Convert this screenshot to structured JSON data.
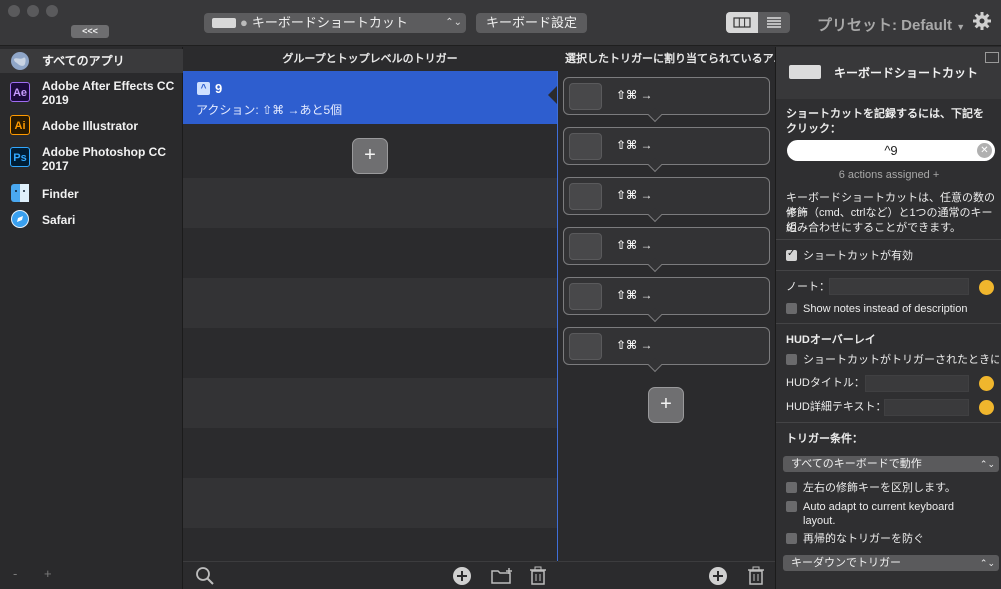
{
  "toolbar": {
    "collapse_label": "<<<",
    "trigger_type": "キーボードショートカット",
    "keyboard_settings": "キーボード設定",
    "preset": "プリセット: Default"
  },
  "headers": {
    "groups": "グループとトップレベルのトリガー",
    "actions": "選択したトリガーに割り当てられているア..."
  },
  "apps": [
    {
      "name": "すべてのアプリ",
      "icon": "globe-icon"
    },
    {
      "name": "Adobe After Effects CC 2019",
      "icon": "after-effects-icon",
      "badge": "Ae"
    },
    {
      "name": "Adobe Illustrator",
      "icon": "illustrator-icon",
      "badge": "Ai"
    },
    {
      "name": "Adobe Photoshop CC 2017",
      "icon": "photoshop-icon",
      "badge": "Ps"
    },
    {
      "name": "Finder",
      "icon": "finder-icon"
    },
    {
      "name": "Safari",
      "icon": "safari-icon"
    }
  ],
  "sidebar_footer": {
    "minus": "-",
    "plus": "+"
  },
  "trigger": {
    "key_symbol": "^",
    "name": "9",
    "subtitle": "アクション: ⇧⌘ →あと5個"
  },
  "plus_label": "+",
  "actions": [
    {
      "label": "⇧⌘ →"
    },
    {
      "label": "⇧⌘ →"
    },
    {
      "label": "⇧⌘ →"
    },
    {
      "label": "⇧⌘ →"
    },
    {
      "label": "⇧⌘ →"
    },
    {
      "label": "⇧⌘ →"
    }
  ],
  "inspector": {
    "title": "キーボードショートカット",
    "record_prompt_1": "ショートカットを記録するには、下記を",
    "record_prompt_2": "クリック：",
    "shortcut_value": "^9",
    "actions_assigned": "6 actions assigned +",
    "desc_1": "キーボードショートカットは、任意の数の修飾",
    "desc_2": "キー（cmd、ctrlなど）と1つの通常のキーの",
    "desc_3": "組み合わせにすることができます。",
    "enabled_label": "ショートカットが有効",
    "enabled": true,
    "note_label": "ノート：",
    "show_notes_label": "Show notes instead of description",
    "hud_section": "HUDオーバーレイ",
    "hud_show_label": "ショートカットがトリガーされたときに表",
    "hud_title_label": "HUDタイトル：",
    "hud_detail_label": "HUD詳細テキスト：",
    "conditions_section": "トリガー条件：",
    "keyboard_popup": "すべてのキーボードで動作",
    "lr_modifier_label": "左右の修飾キーを区別します。",
    "auto_adapt_label_1": "Auto adapt to current keyboard",
    "auto_adapt_label_2": "layout.",
    "prevent_recursive_label": "再帰的なトリガーを防ぐ",
    "keydown_popup": "キーダウンでトリガー"
  },
  "colors": {
    "selection": "#2e5ecf",
    "background": "#2b2b2d"
  }
}
